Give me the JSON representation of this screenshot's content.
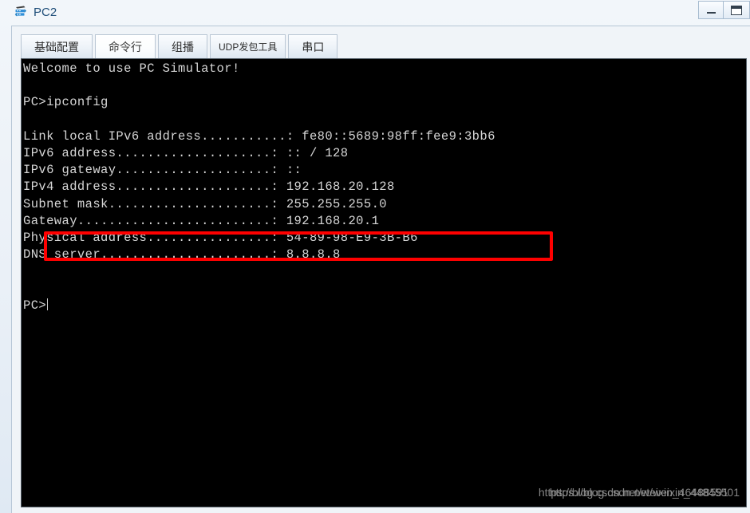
{
  "window": {
    "title": "PC2",
    "icon": "router-icon",
    "controls": {
      "minimize_label": "",
      "minimize_icon": "minimize-icon",
      "maximize_label": "",
      "maximize_icon": "maximize-icon"
    }
  },
  "tabs": [
    {
      "label": "基础配置",
      "active": false
    },
    {
      "label": "命令行",
      "active": true
    },
    {
      "label": "组播",
      "active": false
    },
    {
      "label": "UDP发包工具",
      "active": false
    },
    {
      "label": "串口",
      "active": false
    }
  ],
  "terminal": {
    "welcome": "Welcome to use PC Simulator!",
    "prompt": "PC>",
    "command": "ipconfig",
    "lines": [
      "Welcome to use PC Simulator!",
      "",
      "PC>ipconfig",
      "",
      "Link local IPv6 address...........: fe80::5689:98ff:fee9:3bb6",
      "IPv6 address....................: :: / 128",
      "IPv6 gateway....................: ::",
      "IPv4 address....................: 192.168.20.128",
      "Subnet mask.....................: 255.255.255.0",
      "Gateway.........................: 192.168.20.1",
      "Physical address................: 54-89-98-E9-3B-B6",
      "DNS server......................: 8.8.8.8",
      "",
      "",
      "PC>"
    ],
    "fields": {
      "link_local_ipv6_address": "fe80::5689:98ff:fee9:3bb6",
      "ipv6_address": ":: / 128",
      "ipv6_gateway": "::",
      "ipv4_address": "192.168.20.128",
      "subnet_mask": "255.255.255.0",
      "gateway": "192.168.20.1",
      "physical_address": "54-89-98-E9-3B-B6",
      "dns_server": "8.8.8.8"
    }
  },
  "annotation": {
    "highlight_color": "#fe0000",
    "highlighted_line": "IPv4 address....................: 192.168.20.128"
  },
  "watermark": {
    "line_a": "https://blog.csdn.net/weixin_44845501",
    "line_b": "https://blog.csdn.net/weixin_46488591"
  },
  "colors": {
    "terminal_background": "#000000",
    "terminal_text": "#d6d6d6",
    "title_text": "#1f4e79",
    "accent_red": "#fe0000"
  }
}
